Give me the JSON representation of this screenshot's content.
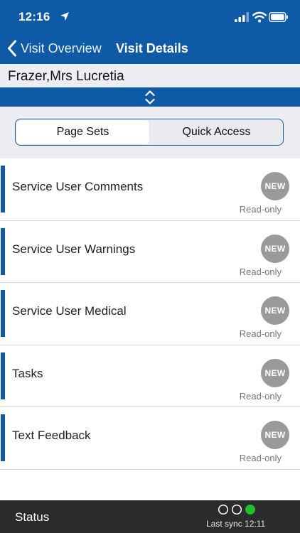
{
  "status_bar": {
    "time": "12:16"
  },
  "nav": {
    "back_label": "Visit Overview",
    "title": "Visit Details"
  },
  "client": {
    "name": "Frazer,Mrs Lucretia"
  },
  "segments": [
    {
      "label": "Page Sets",
      "selected": true
    },
    {
      "label": "Quick Access",
      "selected": false
    }
  ],
  "rows": [
    {
      "title": "Service User Comments",
      "badge": "NEW",
      "status": "Read-only"
    },
    {
      "title": "Service User Warnings",
      "badge": "NEW",
      "status": "Read-only"
    },
    {
      "title": "Service User Medical",
      "badge": "NEW",
      "status": "Read-only"
    },
    {
      "title": "Tasks",
      "badge": "NEW",
      "status": "Read-only"
    },
    {
      "title": "Text Feedback",
      "badge": "NEW",
      "status": "Read-only"
    }
  ],
  "footer": {
    "status_label": "Status",
    "sync_text": "Last sync 12:11",
    "sync_indicators": [
      "empty",
      "empty",
      "green"
    ]
  },
  "colors": {
    "primary": "#0f5aa6",
    "footer_bg": "#2b2b2b",
    "sync_green": "#1fbf2a",
    "badge_gray": "#9a9a9a"
  }
}
